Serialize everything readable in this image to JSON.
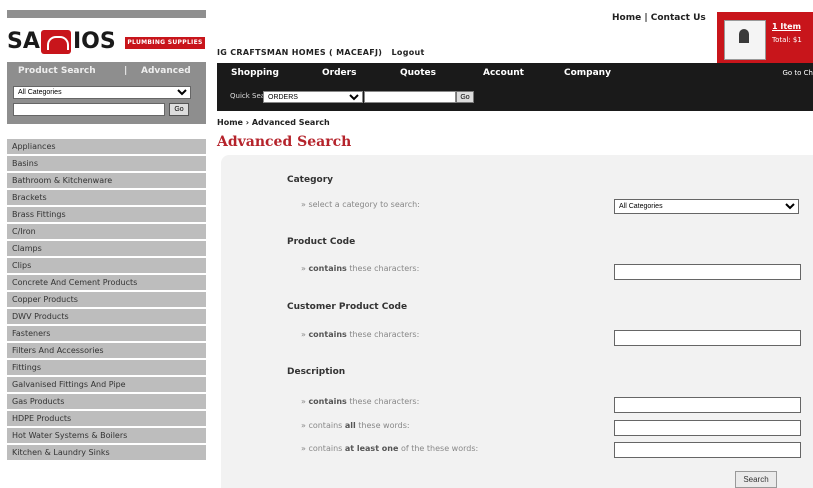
{
  "logo": {
    "part1": "SA",
    "part2": "IOS",
    "tagline": "PLUMBING SUPPLIES"
  },
  "sidebar": {
    "search_tabs": {
      "product_search": "Product Search",
      "separator": "|",
      "advanced": "Advanced"
    },
    "category_select": "All Categories",
    "go_label": "Go",
    "categories": [
      "Appliances",
      "Basins",
      "Bathroom & Kitchenware",
      "Brackets",
      "Brass Fittings",
      "C/Iron",
      "Clamps",
      "Clips",
      "Concrete And Cement Products",
      "Copper Products",
      "DWV Products",
      "Fasteners",
      "Filters And Accessories",
      "Fittings",
      "Galvanised Fittings And Pipe",
      "Gas Products",
      "HDPE Products",
      "Hot Water Systems & Boilers",
      "Kitchen & Laundry Sinks"
    ]
  },
  "header": {
    "links": "Home | Contact Us",
    "cart": {
      "items": "1 Item",
      "total": "Total: $1"
    },
    "account": "IG CRAFTSMAN HOMES ( MACEAFJ)",
    "logout": "Logout"
  },
  "nav": {
    "items": [
      "Shopping",
      "Orders",
      "Quotes",
      "Account",
      "Company"
    ],
    "goto": "Go to Ch",
    "quick_search_label": "Quick Search:",
    "quick_search_select": "ORDERS",
    "go_label": "Go"
  },
  "breadcrumb": "Home › Advanced Search",
  "page_title": "Advanced Search",
  "form": {
    "category": {
      "heading": "Category",
      "label": "» select a category to search:",
      "value": "All Categories"
    },
    "product_code": {
      "heading": "Product Code",
      "label_bold": "contains",
      "label_rest": "these characters:"
    },
    "customer_code": {
      "heading": "Customer Product Code",
      "label_bold": "contains",
      "label_rest": "these characters:"
    },
    "description": {
      "heading": "Description",
      "row1_bold": "contains",
      "row1_rest": "these characters:",
      "row2_pre": "contains",
      "row2_bold": "all",
      "row2_rest": "these words:",
      "row3_pre": "contains",
      "row3_bold": "at least one",
      "row3_rest": "of the these words:"
    },
    "search_button": "Search"
  }
}
